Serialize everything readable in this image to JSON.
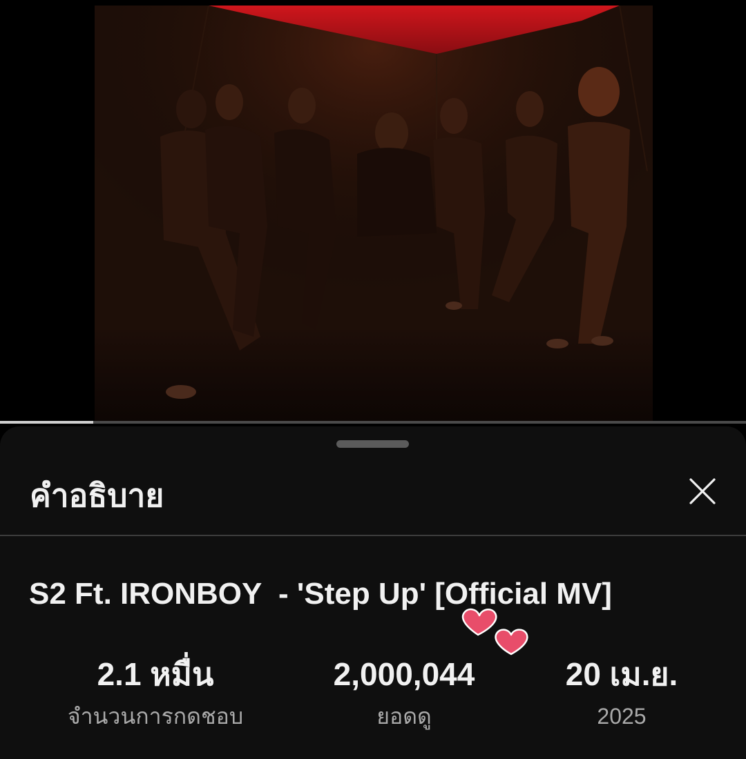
{
  "video": {
    "progress_fraction": 0.125
  },
  "sheet": {
    "title": "คำอธิบาย",
    "close_icon": "close-icon"
  },
  "video_info": {
    "title": "S2 Ft. IRONBOY  - 'Step Up' [Official MV]",
    "sticker_icon": "hearts-sticker-icon"
  },
  "stats": {
    "likes_value": "2.1 หมื่น",
    "likes_label": "จำนวนการกดชอบ",
    "views_value": "2,000,044",
    "views_label": "ยอดดู",
    "date_value": "20 เม.ย.",
    "date_year": "2025"
  },
  "colors": {
    "background": "#0f0f0f",
    "text_primary": "#f1f1f1",
    "text_secondary": "#aaaaaa",
    "heart": "#e84d6a",
    "video_ceiling": "#c8141a"
  }
}
